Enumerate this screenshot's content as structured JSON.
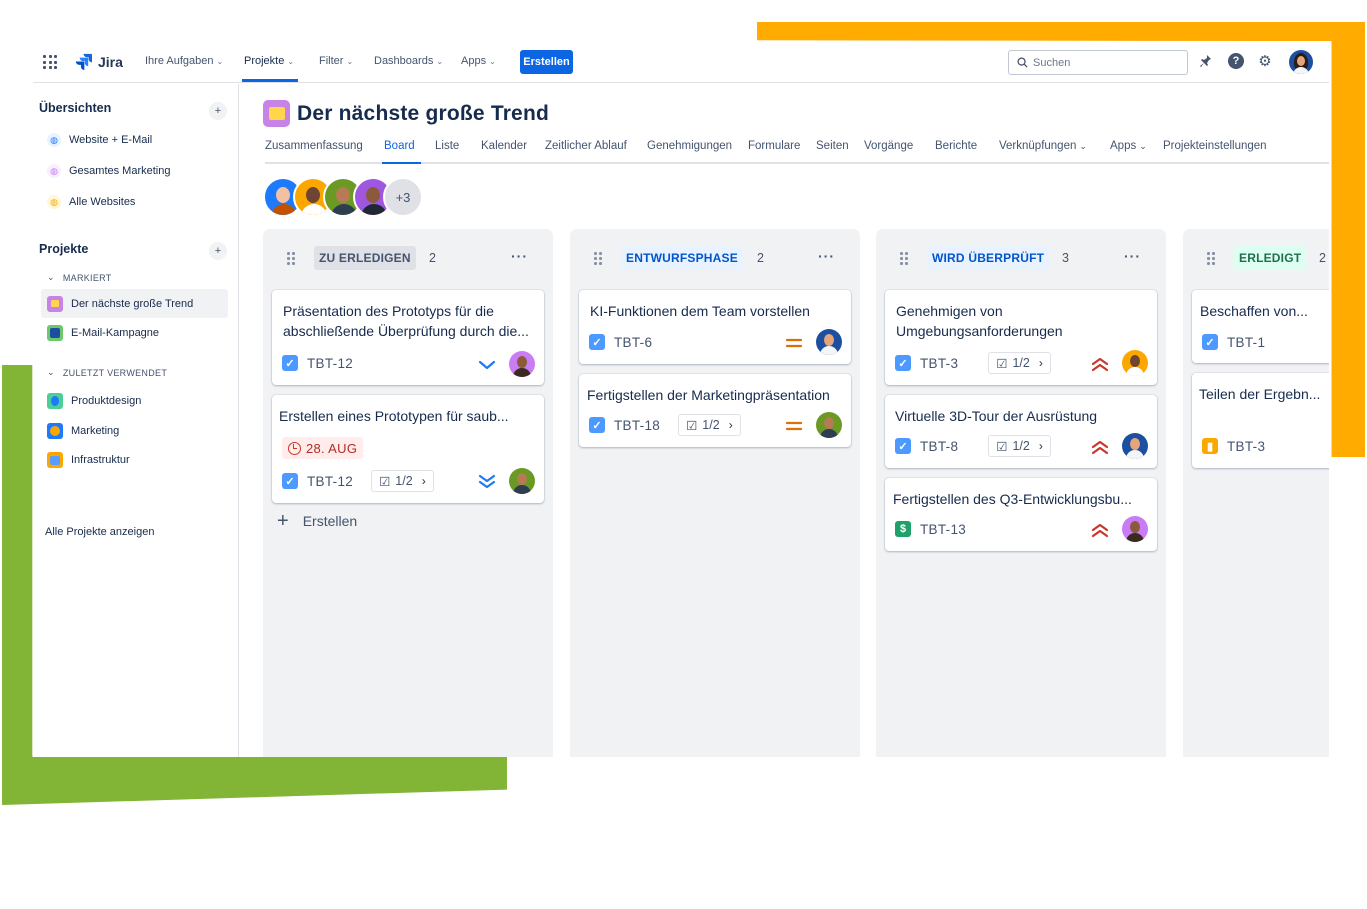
{
  "colors": {
    "accent": "#0c66e4",
    "deco_orange": "#ffab00",
    "deco_green": "#82b536",
    "todo_badge_bg": "#dfe1e6",
    "draft_badge_bg": "#e9f2ff",
    "review_badge_bg": "#e9f2ff",
    "done_badge_bg": "#dcfff1"
  },
  "topnav": {
    "app_name": "Jira",
    "items": [
      {
        "label": "Ihre Aufgaben",
        "icon": "chevron-down-icon"
      },
      {
        "label": "Projekte",
        "icon": "chevron-down-icon",
        "active": true
      },
      {
        "label": "Filter",
        "icon": "chevron-down-icon"
      },
      {
        "label": "Dashboards",
        "icon": "chevron-down-icon"
      },
      {
        "label": "Apps",
        "icon": "chevron-down-icon"
      }
    ],
    "create_label": "Erstellen",
    "search_placeholder": "Suchen",
    "icons": [
      "notification-icon",
      "help-icon",
      "settings-icon",
      "profile-avatar"
    ]
  },
  "sidebar": {
    "overview_heading": "Übersichten",
    "overview_items": [
      {
        "label": "Website + E-Mail",
        "color": "#1d7afc"
      },
      {
        "label": "Gesamtes Marketing",
        "color": "#c97cf4"
      },
      {
        "label": "Alle Websites",
        "color": "#fca700"
      }
    ],
    "projects_heading": "Projekte",
    "starred_label": "MARKIERT",
    "starred_items": [
      {
        "label": "Der nächste große Trend",
        "selected": true
      },
      {
        "label": "E-Mail-Kampagne"
      }
    ],
    "recent_label": "ZULETZT VERWENDET",
    "recent_items": [
      {
        "label": "Produktdesign"
      },
      {
        "label": "Marketing"
      },
      {
        "label": "Infrastruktur"
      }
    ],
    "all_projects_label": "Alle Projekte anzeigen"
  },
  "project": {
    "title": "Der nächste große Trend",
    "tabs": [
      {
        "label": "Zusammenfassung"
      },
      {
        "label": "Board",
        "active": true
      },
      {
        "label": "Liste"
      },
      {
        "label": "Kalender"
      },
      {
        "label": "Zeitlicher Ablauf"
      },
      {
        "label": "Genehmigungen"
      },
      {
        "label": "Formulare"
      },
      {
        "label": "Seiten"
      },
      {
        "label": "Vorgänge"
      },
      {
        "label": "Berichte"
      },
      {
        "label": "Verknüpfungen",
        "dropdown": true
      },
      {
        "label": "Apps",
        "dropdown": true
      },
      {
        "label": "Projekteinstellungen"
      }
    ],
    "people_more": "+3"
  },
  "board": {
    "create_label": "Erstellen",
    "columns": [
      {
        "title": "ZU ERLEDIGEN",
        "count": "2",
        "cards": [
          {
            "title": "Präsentation des Prototyps für die abschließende Überprüfung durch die...",
            "key": "TBT-12",
            "type": "task",
            "priority": "low"
          },
          {
            "title": "Erstellen eines Prototypen für saub...",
            "due": "28. AUG",
            "key": "TBT-12",
            "type": "task",
            "subtasks": "1/2",
            "priority": "lowest"
          }
        ]
      },
      {
        "title": "ENTWURFSPHASE",
        "count": "2",
        "cards": [
          {
            "title": "KI-Funktionen dem Team vorstellen",
            "key": "TBT-6",
            "type": "task",
            "priority": "medium"
          },
          {
            "title": "Fertigstellen der Marketingpräsentation",
            "key": "TBT-18",
            "type": "task",
            "subtasks": "1/2",
            "priority": "medium"
          }
        ]
      },
      {
        "title": "WIRD ÜBERPRÜFT",
        "count": "3",
        "cards": [
          {
            "title": "Genehmigen von Umgebungsanforderungen",
            "key": "TBT-3",
            "type": "task",
            "subtasks": "1/2",
            "priority": "high"
          },
          {
            "title": "Virtuelle 3D-Tour der Ausrüstung",
            "key": "TBT-8",
            "type": "task",
            "subtasks": "1/2",
            "priority": "high"
          },
          {
            "title": "Fertigstellen des Q3-Entwicklungsbu...",
            "key": "TBT-13",
            "type": "budget",
            "priority": "high"
          }
        ]
      },
      {
        "title": "ERLEDIGT",
        "count": "2",
        "cards": [
          {
            "title": "Beschaffen von...",
            "key": "TBT-1",
            "type": "task"
          },
          {
            "title": "Teilen der Ergebn...",
            "key": "TBT-3",
            "type": "page"
          }
        ]
      }
    ]
  }
}
